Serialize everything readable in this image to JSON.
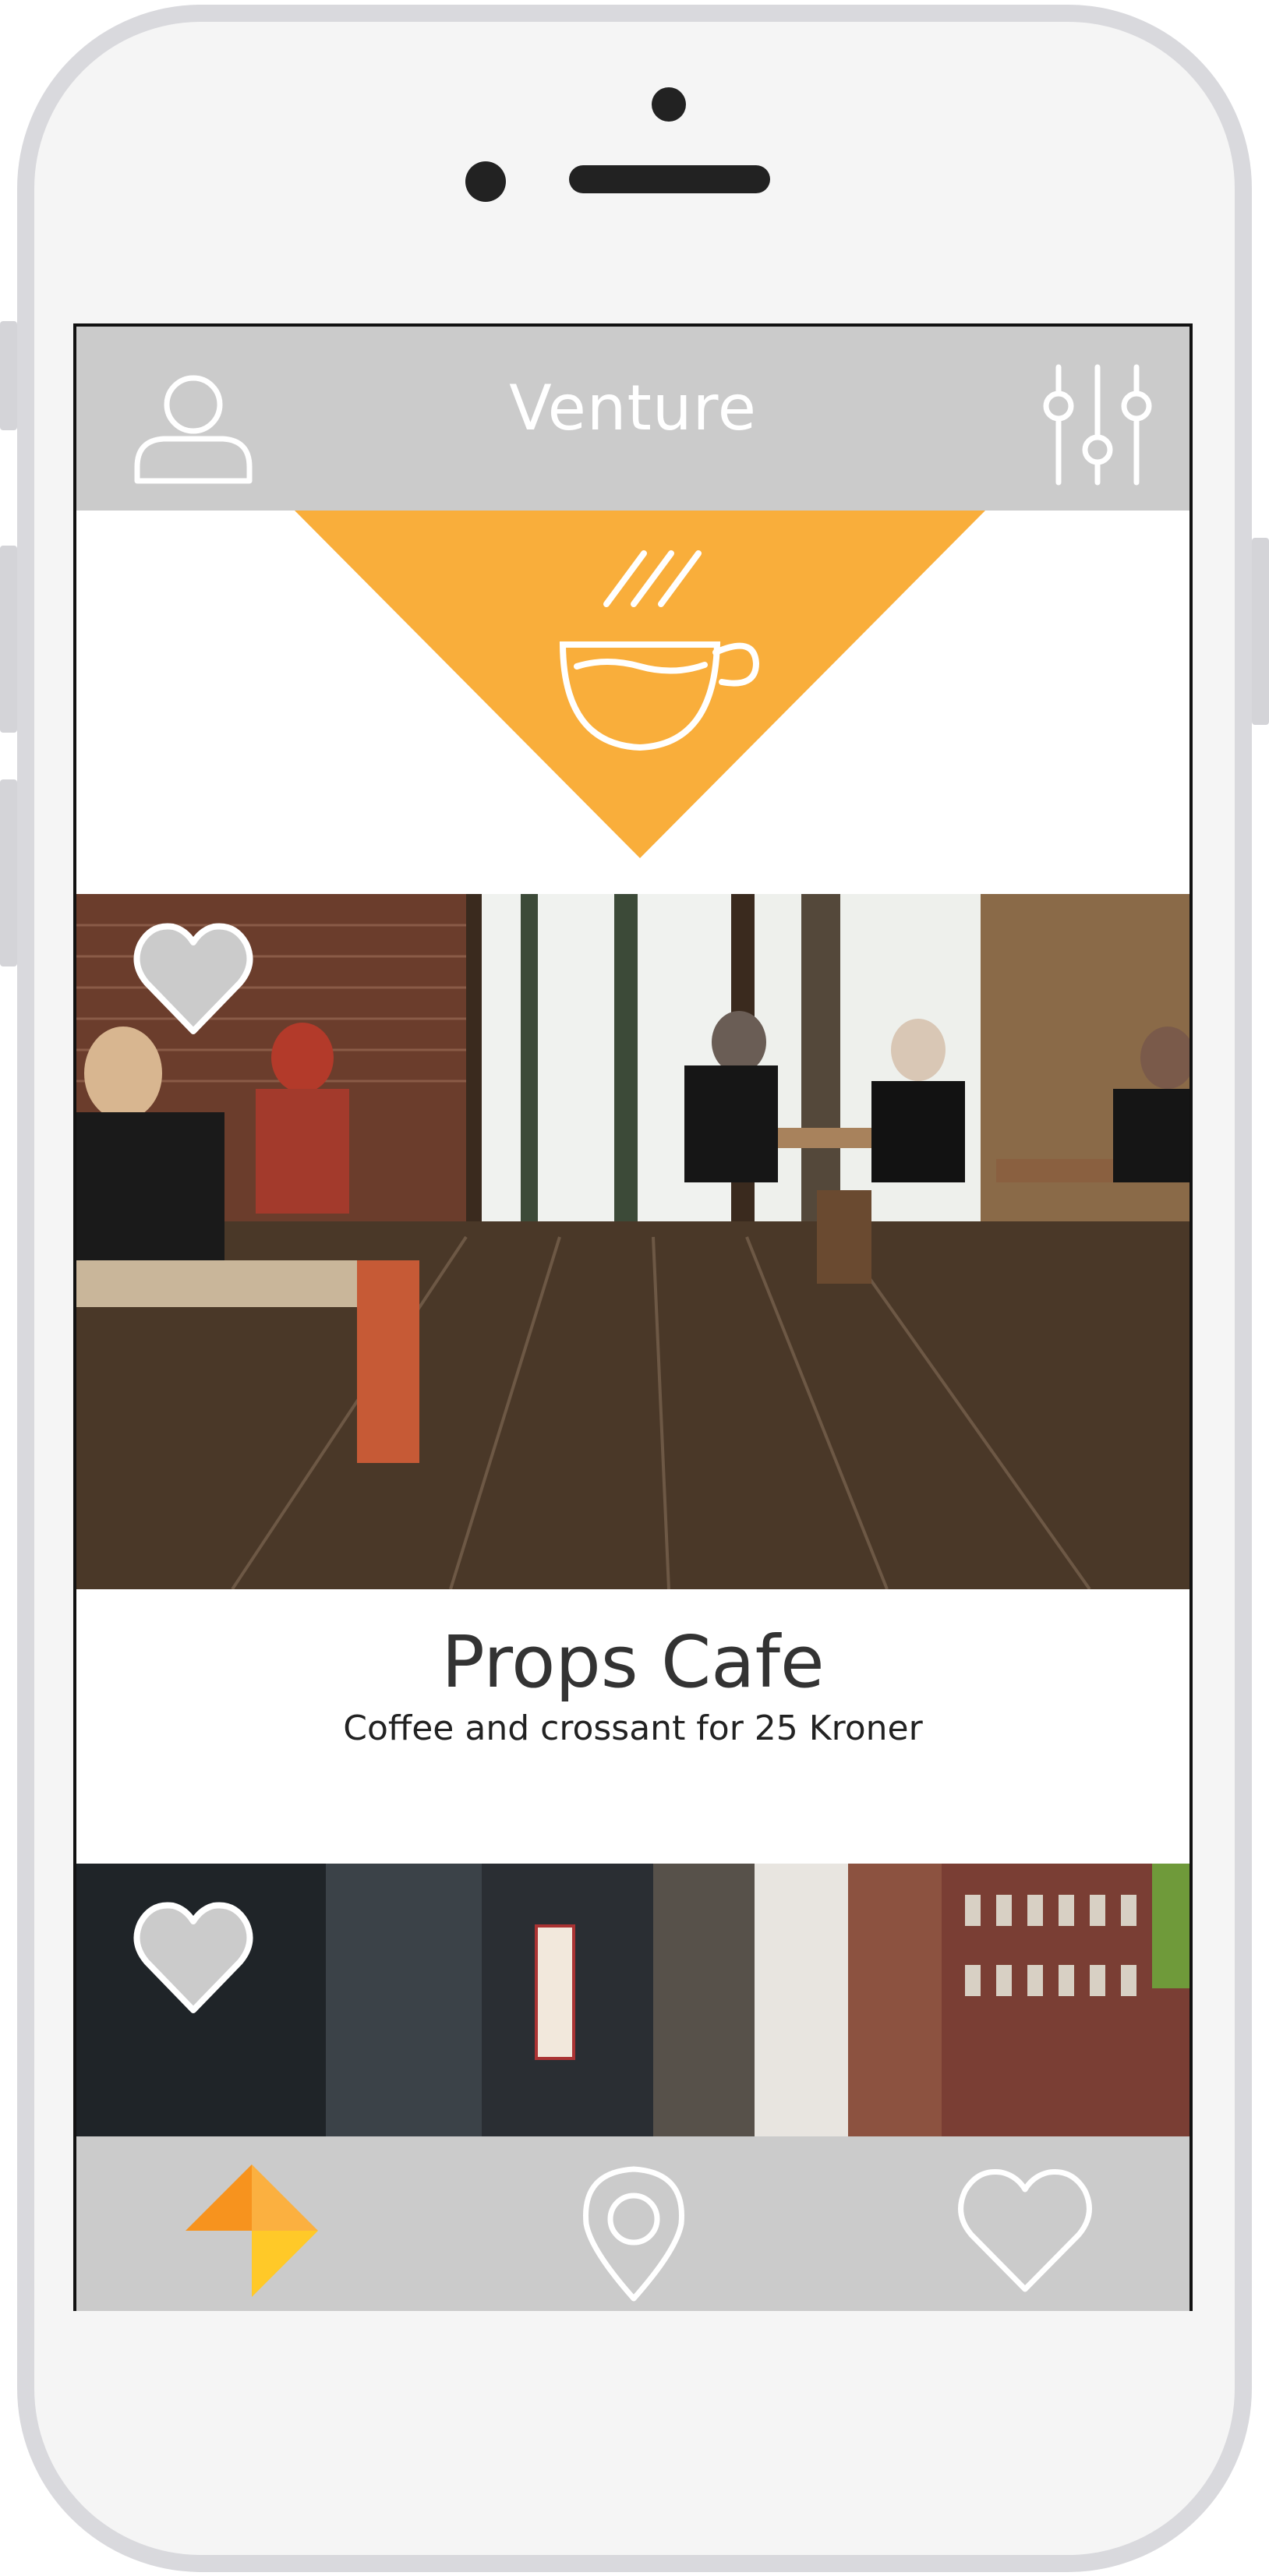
{
  "header": {
    "app_title": "Venture",
    "profile_icon": "user-icon",
    "filter_icon": "sliders-icon"
  },
  "category": {
    "icon": "coffee-cup-icon",
    "color": "#F9AE3B"
  },
  "cards": [
    {
      "title": "Props Cafe",
      "subtitle": "Coffee and crossant for 25 Kroner",
      "favorite_icon": "heart-icon"
    },
    {
      "favorite_icon": "heart-icon"
    }
  ],
  "bottom_nav": {
    "items": [
      {
        "icon": "venture-logo-icon"
      },
      {
        "icon": "map-pin-icon"
      },
      {
        "icon": "heart-icon"
      }
    ]
  },
  "colors": {
    "bar_gray": "#CBCBCB",
    "accent_orange": "#F9AE3B",
    "logo_orange": "#F7931E",
    "logo_yellow": "#FFC928",
    "icon_white": "#FFFFFF"
  }
}
